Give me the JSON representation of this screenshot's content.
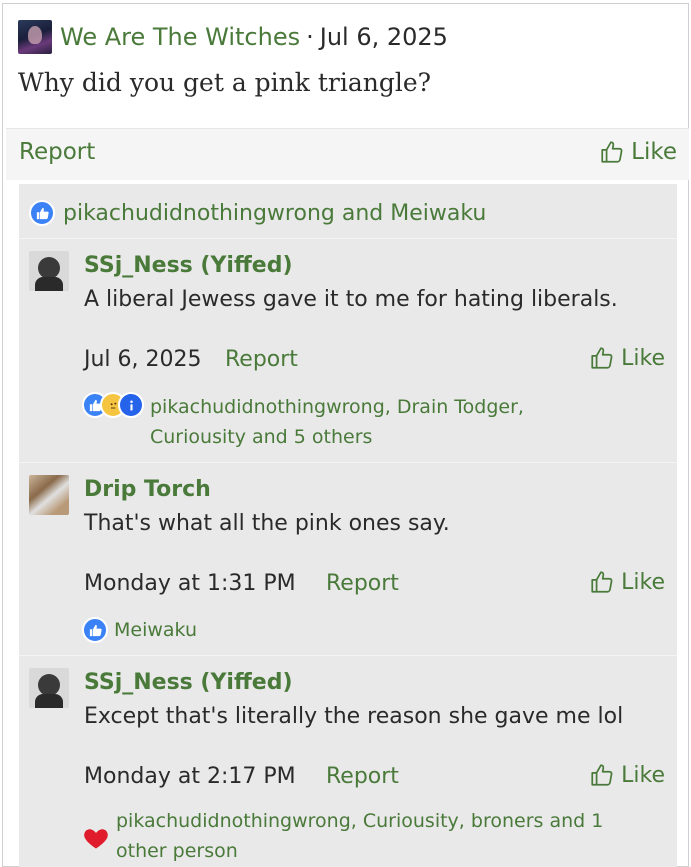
{
  "post": {
    "author": "We Are The Witches",
    "separator": "·",
    "date": "Jul 6, 2025",
    "body": "Why did you get a pink triangle?",
    "report_label": "Report",
    "like_label": "Like",
    "reactions": "pikachudidnothingwrong and Meiwaku"
  },
  "comments": [
    {
      "author": "SSj_Ness (Yiffed)",
      "text": "A liberal Jewess gave it to me for hating liberals.",
      "date": "Jul 6, 2025",
      "report_label": "Report",
      "like_label": "Like",
      "reactions_line1": "pikachudidnothingwrong, Drain Todger,",
      "reactions_line2": "Curiousity and 5 others"
    },
    {
      "author": "Drip Torch",
      "text": "That's what all the pink ones say.",
      "date": "Monday at 1:31 PM",
      "report_label": "Report",
      "like_label": "Like",
      "reactions_line1": "Meiwaku"
    },
    {
      "author": "SSj_Ness (Yiffed)",
      "text": "Except that's literally the reason she gave me lol",
      "date": "Monday at 2:17 PM",
      "report_label": "Report",
      "like_label": "Like",
      "reactions_line1": "pikachudidnothingwrong, Curiousity, broners and 1",
      "reactions_line2": "other person"
    }
  ],
  "icons": {
    "like": "thumbs-up-outline-icon",
    "reaction_like": "thumbs-up-reaction-icon",
    "reaction_thinking": "thinking-face-icon",
    "reaction_info": "info-icon",
    "reaction_love": "heart-icon"
  },
  "colors": {
    "accent_green": "#4a7a3a",
    "reaction_blue": "#3b82f6",
    "heart_red": "#e01b2b",
    "thread_bg": "#e9e9e9"
  }
}
